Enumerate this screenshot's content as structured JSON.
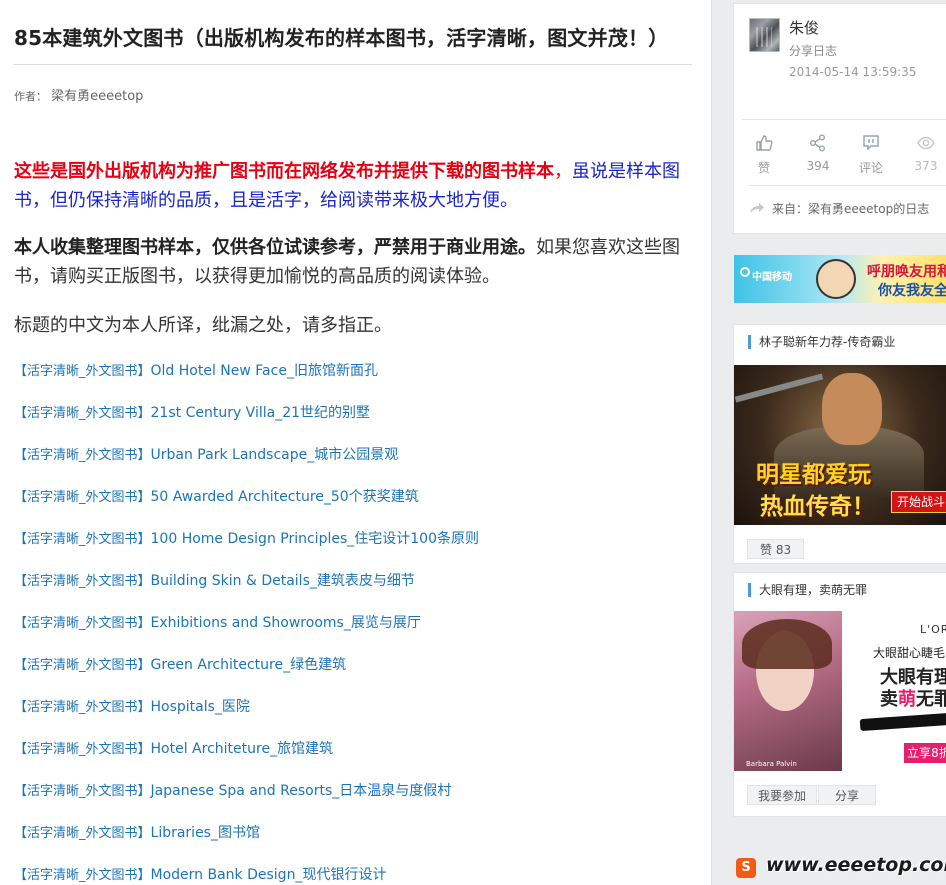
{
  "article": {
    "title": "85本建筑外文图书（出版机构发布的样本图书，活字清晰，图文并茂！）",
    "author_label": "作者：",
    "author_name": "梁有勇eeeetop",
    "p1_red": "这些是国外出版机构为推广图书而在网络发布并提供下载的图书样本",
    "p1_comma": "，",
    "p1_blue": "虽说是样本图书，但仍保持清晰的品质，且是活字，给阅读带来极大地方便。",
    "p2_bold": "本人收集整理图书样本，仅供各位试读参考，严禁用于商业用途。",
    "p2_rest": "如果您喜欢这些图书，请购买正版图书，以获得更加愉悦的高品质的阅读体验。",
    "p3": "标题的中文为本人所译，纰漏之处，请多指正。",
    "link_tag": "【活字清晰_外文图书】",
    "links": [
      "Old Hotel New Face_旧旅馆新面孔",
      "21st Century Villa_21世纪的别墅",
      "Urban Park Landscape_城市公园景观",
      "50 Awarded Architecture_50个获奖建筑",
      "100 Home Design Principles_住宅设计100条原则",
      "Building Skin & Details_建筑表皮与细节",
      "Exhibitions and Showrooms_展览与展厅",
      "Green Architecture_绿色建筑",
      "Hospitals_医院",
      "Hotel Architeture_旅馆建筑",
      "Japanese Spa and Resorts_日本温泉与度假村",
      "Libraries_图书馆",
      "Modern Bank Design_现代银行设计"
    ]
  },
  "profile": {
    "name": "朱俊",
    "type": "分享日志",
    "time": "2014-05-14 13:59:35",
    "actions": {
      "like": "赞",
      "share": "394",
      "comment": "评论",
      "views": "373"
    },
    "source": "来自：梁有勇eeeetop的日志"
  },
  "banner": {
    "carrier": "中国移动",
    "line1": "呼朋唤友用和",
    "line2": "你友我友全"
  },
  "ads": [
    {
      "title": "林子聪新年力荐-传奇霸业",
      "line1": "明星都爱玩",
      "line2": "热血传奇！",
      "button": "开始战斗",
      "likes": "赞 83"
    },
    {
      "title": "大眼有理，卖萌无罪",
      "brand": "L'ORÉAL",
      "line1": "大眼甜心睫毛",
      "line2": "大眼有理",
      "line3a": "卖",
      "line3b": "萌",
      "line3c": "无罪",
      "caption": "Barbara Palvin",
      "cta": "立享8折",
      "join": "我要参加",
      "share": "分享"
    }
  ],
  "watermark": {
    "text": "www.eeeetop.com",
    "sogou": "S"
  },
  "colors": {
    "link": "#1c74b8",
    "red": "#e60012",
    "blue": "#1a24c9",
    "accent_bar": "#4e9ad6"
  }
}
